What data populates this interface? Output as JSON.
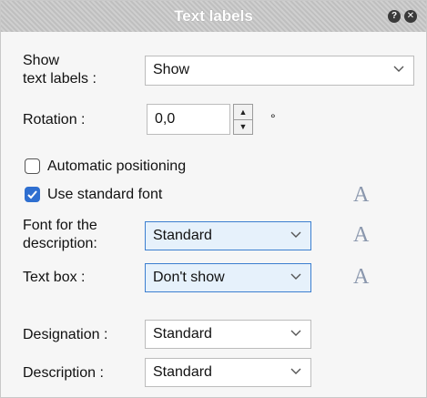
{
  "window": {
    "title": "Text labels"
  },
  "show_labels": {
    "label_line1": "Show",
    "label_line2": "text labels :",
    "value": "Show"
  },
  "rotation": {
    "label": "Rotation :",
    "value": "0,0",
    "unit": "°"
  },
  "auto_positioning": {
    "label": "Automatic positioning",
    "checked": false
  },
  "standard_font": {
    "label": "Use standard font",
    "checked": true
  },
  "font_description": {
    "label_line1": "Font for the",
    "label_line2": "description:",
    "value": "Standard"
  },
  "text_box": {
    "label": "Text box :",
    "value": "Don't show"
  },
  "designation": {
    "label": "Designation :",
    "value": "Standard"
  },
  "description": {
    "label": "Description :",
    "value": "Standard"
  },
  "icons": {
    "help": "help-icon",
    "close": "close-icon",
    "font_sample": "A"
  },
  "colors": {
    "accent": "#2f6fd0",
    "highlight_bg": "#e6f1fb",
    "font_icon": "#8a97ad"
  }
}
